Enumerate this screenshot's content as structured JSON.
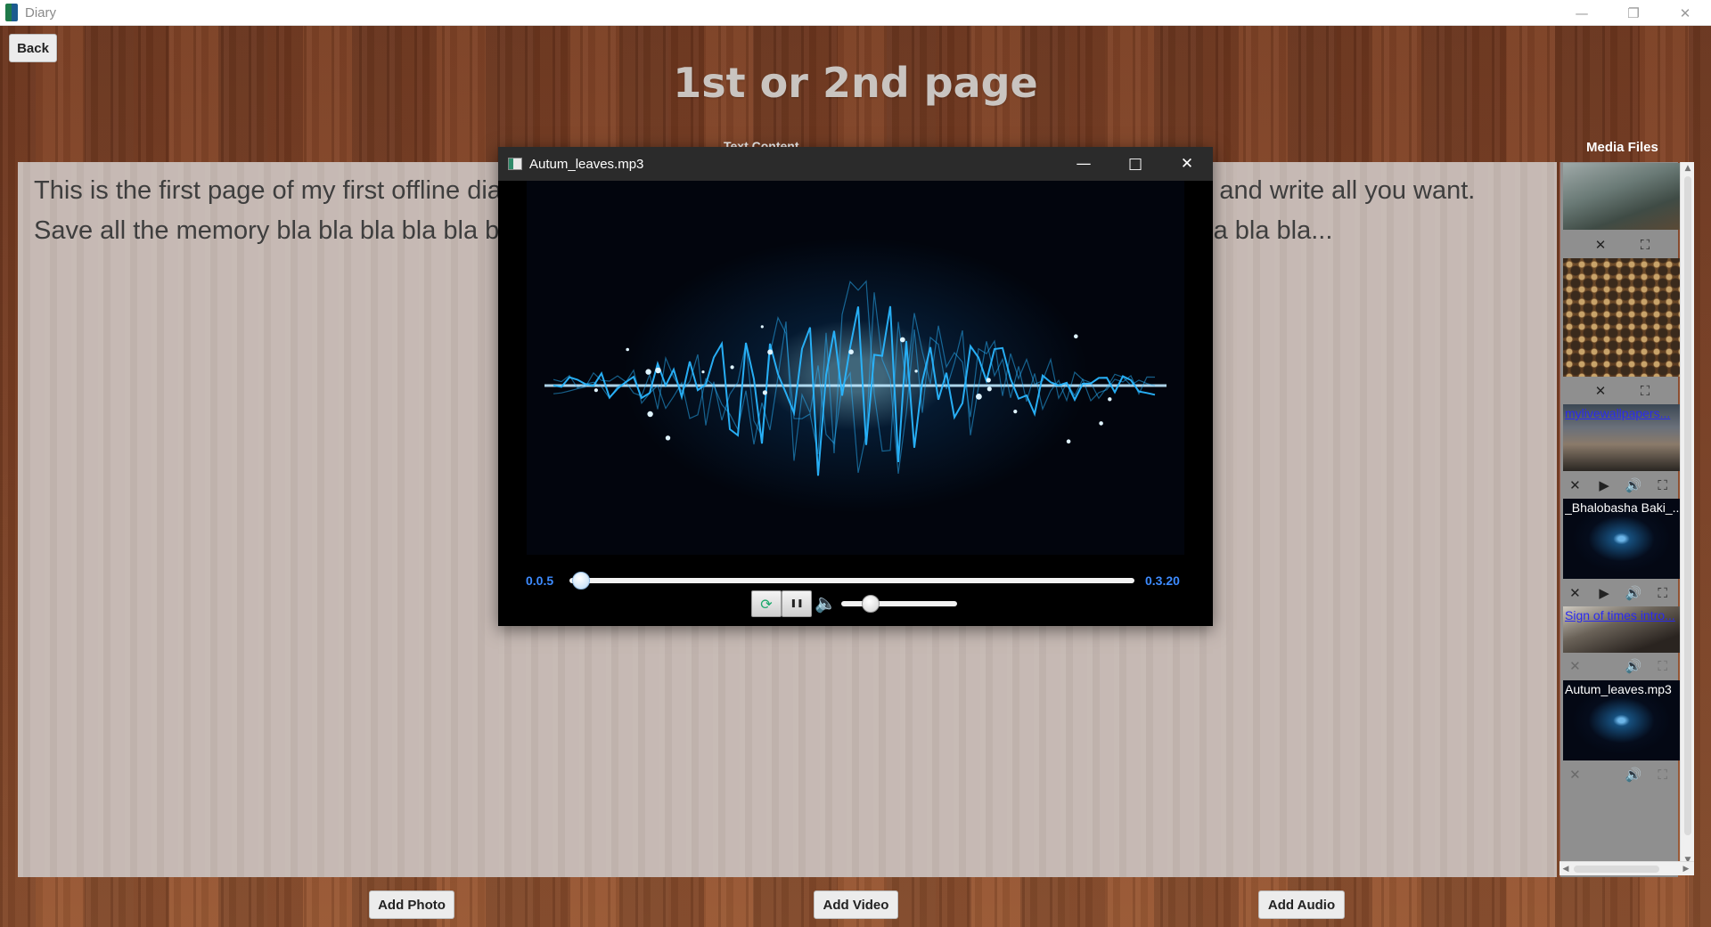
{
  "window": {
    "title": "Diary",
    "minimize": "—",
    "restore": "❐",
    "close": "✕"
  },
  "header": {
    "back_label": "Back",
    "page_title": "1st or 2nd page",
    "text_content_label": "Text Content",
    "media_files_label": "Media Files"
  },
  "text_area": {
    "content": "This is the first page of my first offline diary. Here you can add text, photos, videos, audios. So have fun and write all you want. Save all the memory bla bla bla bla bla bla bla bla bla bla bla bla bla bla bla bla bla bla bla bla bla bla bla bla bla..."
  },
  "media_panel": {
    "items": [
      {
        "caption": ""
      },
      {
        "caption": ""
      },
      {
        "caption": "mylivewallpapers..."
      },
      {
        "caption": "_Bhalobasha Baki_..."
      },
      {
        "caption": "Sign of times intro..."
      },
      {
        "caption": "Autum_leaves.mp3"
      }
    ],
    "icons": {
      "remove": "✕",
      "play": "▶",
      "volume": "🔊",
      "fullscreen": "⛶"
    }
  },
  "footer": {
    "add_photo": "Add Photo",
    "add_video": "Add Video",
    "add_audio": "Add Audio"
  },
  "player": {
    "title": "Autum_leaves.mp3",
    "minimize": "—",
    "maximize": "□",
    "close": "✕",
    "current_time": "0.0.5",
    "total_time": "0.3.20",
    "seek_fraction": 0.02,
    "volume_fraction": 0.25,
    "restart_icon": "⟳",
    "pause_icon": "❚❚",
    "volume_icon": "🔈"
  },
  "colors": {
    "accent_time": "#3d8bff",
    "wave": "#29b6ff"
  }
}
